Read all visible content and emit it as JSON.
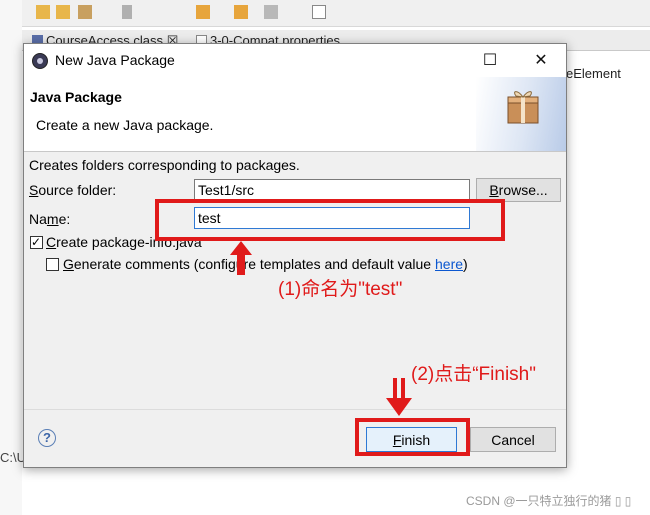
{
  "ide": {
    "tabs": [
      {
        "label": "CourseAccess.class ☒"
      },
      {
        "label": "3-0-Compat.properties"
      }
    ],
    "right_text": "eElement",
    "left_text": "C:\\U"
  },
  "dialog": {
    "title": "New Java Package",
    "controls": {
      "maximize": "☐",
      "close": "✕"
    },
    "banner_title": "Java Package",
    "banner_description": "Create a new Java package.",
    "info_text": "Creates folders corresponding to packages.",
    "source_folder_label": "Source folder:",
    "source_folder_value": "Test1/src",
    "browse_label": "Browse...",
    "name_label": "Name:",
    "name_value": "test",
    "create_package_info": {
      "label": "Create package-info.java",
      "checked": true
    },
    "generate_comments": {
      "label": "Generate comments (configure templates and default value ",
      "link": "here",
      "suffix": ")",
      "checked": false
    },
    "help": "?",
    "finish_label": "Finish",
    "cancel_label": "Cancel"
  },
  "annotations": {
    "step1": "(1)命名为\"test\"",
    "step2": "(2)点击“Finish\"",
    "accent_color": "#e01a1a"
  },
  "watermark": "CSDN @一只特立独行的猪 ▯ ▯"
}
